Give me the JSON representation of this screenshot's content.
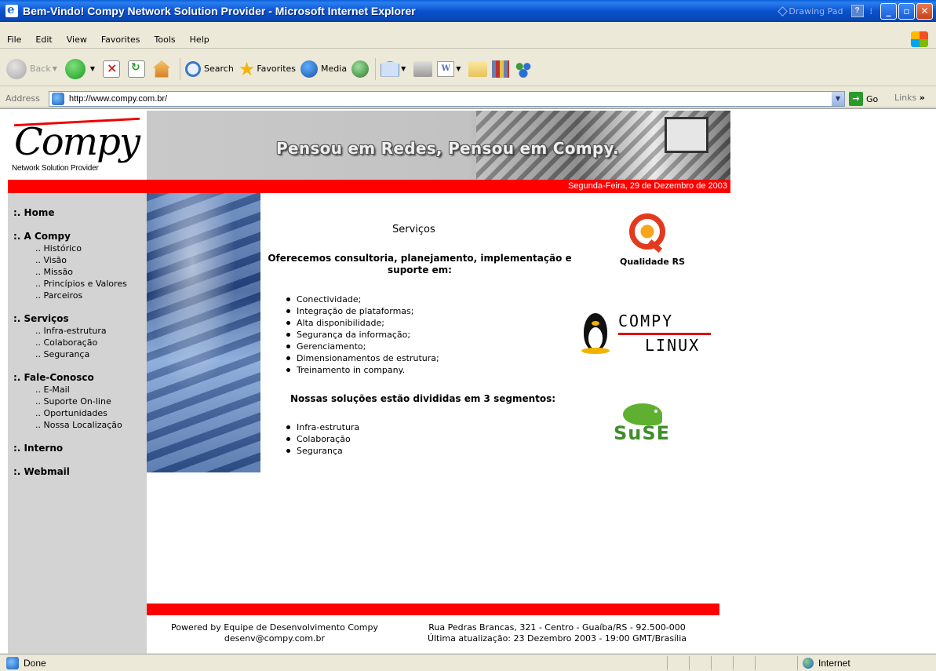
{
  "window": {
    "title": "Bem-Vindo! Compy Network Solution Provider - Microsoft Internet Explorer",
    "drawing_pad": "Drawing Pad",
    "help_icon": "?",
    "minimize": "_",
    "maximize": "▫",
    "close": "✕"
  },
  "menu": [
    "File",
    "Edit",
    "View",
    "Favorites",
    "Tools",
    "Help"
  ],
  "toolbar": {
    "back": "Back",
    "search": "Search",
    "favorites": "Favorites",
    "media": "Media",
    "word_icon": "W"
  },
  "address": {
    "label": "Address",
    "url": "http://www.compy.com.br/",
    "go": "Go",
    "links": "Links"
  },
  "site": {
    "brand": "Compy",
    "tagline": "Network Solution Provider",
    "banner_slogan": "Pensou em Redes, Pensou em Compy.",
    "date": "Segunda-Feira, 29 de Dezembro de 2003"
  },
  "nav": {
    "home": ":. Home",
    "a_compy": ":. A Compy",
    "a_compy_items": [
      ".. Histórico",
      ".. Visão",
      ".. Missão",
      ".. Princípios e Valores",
      ".. Parceiros"
    ],
    "servicos": ":. Serviços",
    "servicos_items": [
      ".. Infra-estrutura",
      ".. Colaboração",
      ".. Segurança"
    ],
    "fale": ":. Fale-Conosco",
    "fale_items": [
      ".. E-Mail",
      ".. Suporte On-line",
      ".. Oportunidades",
      ".. Nossa Localização"
    ],
    "interno": ":. Interno",
    "webmail": ":. Webmail"
  },
  "content": {
    "title": "Serviços",
    "intro": "Oferecemos consultoria, planejamento, implementação e suporte em:",
    "services": [
      "Conectividade;",
      "Integração de plataformas;",
      "Alta disponibilidade;",
      "Segurança da informação;",
      "Gerenciamento;",
      "Dimensionamentos de estrutura;",
      "Treinamento in company."
    ],
    "segments_title": "Nossas soluções estão divididas em 3 segmentos:",
    "segments": [
      "Infra-estrutura",
      "Colaboração",
      "Segurança"
    ]
  },
  "partners": {
    "qualidade": "Qualidade RS",
    "compy_linux_1": "COMPY",
    "compy_linux_2": "LINUX",
    "suse": "SuSE"
  },
  "footer": {
    "powered_by": "Powered by Equipe de Desenvolvimento Compy",
    "email": "desenv@compy.com.br",
    "address": "Rua Pedras Brancas, 321 - Centro - Guaíba/RS - 92.500-000",
    "updated": "Última atualização: 23 Dezembro 2003 - 19:00 GMT/Brasília"
  },
  "status": {
    "text": "Done",
    "zone": "Internet"
  }
}
